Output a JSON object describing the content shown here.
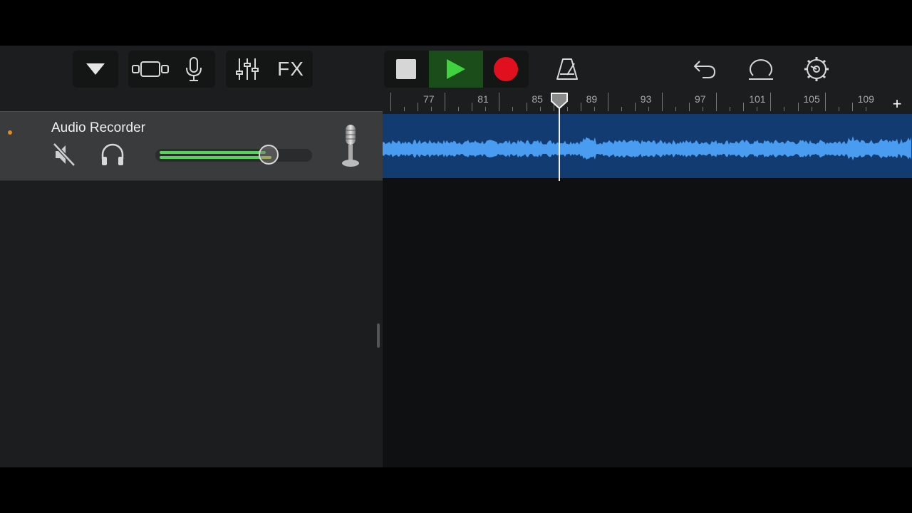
{
  "toolbar": {
    "browser_icon": "triangle-down-icon",
    "tracks_view_icon": "tracks-view-icon",
    "instrument_icon": "microphone-icon",
    "mixer_icon": "mixer-sliders-icon",
    "fx_label": "FX",
    "stop_icon": "stop-icon",
    "play_icon": "play-icon",
    "record_icon": "record-icon",
    "metronome_icon": "metronome-icon",
    "undo_icon": "undo-icon",
    "loop_icon": "loop-icon",
    "settings_icon": "gear-icon"
  },
  "colors": {
    "play_active_bg": "#1a4d1a",
    "play_green": "#3fd33f",
    "record_red": "#e0101f",
    "region_blue": "#123b72",
    "waveform": "#4a9cf0",
    "volume_green": "#57d35a",
    "track_dot": "#e38a1e"
  },
  "ruler": {
    "labels": [
      "77",
      "81",
      "85",
      "89",
      "93",
      "97",
      "101",
      "105",
      "109"
    ],
    "add_label": "+"
  },
  "track": {
    "name": "Audio Recorder",
    "mute_icon": "speaker-muted-icon",
    "solo_icon": "headphones-icon",
    "volume_level": 0.68,
    "instrument_icon": "microphone-icon"
  },
  "add_track_label": "+"
}
